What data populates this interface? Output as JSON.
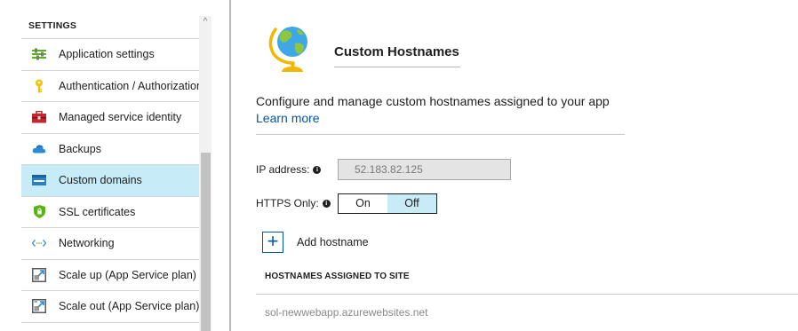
{
  "sidebar": {
    "section_title": "SETTINGS",
    "items": [
      {
        "label": "Application settings",
        "icon": "sliders-icon"
      },
      {
        "label": "Authentication / Authorization",
        "icon": "key-icon"
      },
      {
        "label": "Managed service identity",
        "icon": "toolbox-icon"
      },
      {
        "label": "Backups",
        "icon": "cloud-backup-icon"
      },
      {
        "label": "Custom domains",
        "icon": "www-icon",
        "active": true
      },
      {
        "label": "SSL certificates",
        "icon": "shield-icon"
      },
      {
        "label": "Networking",
        "icon": "network-arrows-icon"
      },
      {
        "label": "Scale up (App Service plan)",
        "icon": "scale-up-icon"
      },
      {
        "label": "Scale out (App Service plan)",
        "icon": "scale-out-icon"
      }
    ],
    "scroll_up_arrow": "^"
  },
  "main": {
    "title": "Custom Hostnames",
    "description": "Configure and manage custom hostnames assigned to your app",
    "learn_more": "Learn more",
    "ip_label": "IP address:",
    "ip_value": "52.183.82.125",
    "https_label": "HTTPS Only:",
    "info_glyph": "i",
    "https_toggle": {
      "on_label": "On",
      "off_label": "Off",
      "selected": "Off"
    },
    "add_hostname_label": "Add hostname",
    "add_glyph": "+",
    "table_header": "HOSTNAMES ASSIGNED TO SITE",
    "hostnames": [
      "sol-newwebapp.azurewebsites.net"
    ]
  },
  "colors": {
    "accent": "#0058ad",
    "active_bg": "#c7ecf7",
    "key_yellow": "#f2c200",
    "toolbox_red": "#c4262e",
    "shield_green": "#5bb317"
  }
}
